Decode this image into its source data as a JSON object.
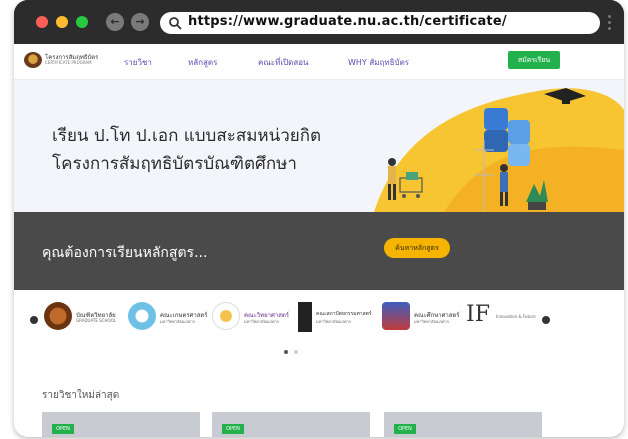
{
  "browser": {
    "url": "https://www.graduate.nu.ac.th/certificate/",
    "back_glyph": "←",
    "forward_glyph": "→"
  },
  "site": {
    "logo_title": "โครงการสัมฤทธิบัตร",
    "logo_subtitle": "CERTIFICATE PROGRAM",
    "nav": [
      {
        "label": "รายวิชา"
      },
      {
        "label": "หลักสูตร"
      },
      {
        "label": "คณะที่เปิดสอน"
      },
      {
        "label": "WHY สัมฤทธิบัตร"
      }
    ],
    "enroll_label": "สมัครเรียน"
  },
  "hero": {
    "line1": "เรียน ป.โท ป.เอก แบบสะสมหน่วยกิต",
    "line2": "โครงการสัมฤทธิบัตรบัณฑิตศึกษา"
  },
  "search": {
    "prompt": "คุณต้องการเรียนหลักสูตร...",
    "button_label": "ค้นหาหลักสูตร"
  },
  "partners": [
    {
      "name": "บัณฑิตวิทยาลัย",
      "sub": "GRADUATE SCHOOL"
    },
    {
      "name": "คณะเกษตรศาสตร์",
      "sub": "มหาวิทยาลัยนเรศวร"
    },
    {
      "name": "คณะวิทยาศาสตร์",
      "sub": "มหาวิทยาลัยนเรศวร"
    },
    {
      "name": "คณะสถาปัตยกรรมศาสตร์",
      "sub": "มหาวิทยาลัยนเรศวร"
    },
    {
      "name": "คณะศึกษาศาสตร์",
      "sub": "มหาวิทยาลัยนเรศวร"
    },
    {
      "name": "IF",
      "sub": "Innovation & Future"
    }
  ],
  "latest": {
    "heading": "รายวิชาใหม่ล่าสุด",
    "cards": [
      {
        "badge": "OPEN"
      },
      {
        "badge": "OPEN"
      },
      {
        "badge": "OPEN"
      }
    ]
  },
  "colors": {
    "accent_green": "#22b14c",
    "accent_yellow": "#f4b400",
    "nav_purple": "#5a4bb0",
    "band_dark": "#4a4a4a"
  }
}
